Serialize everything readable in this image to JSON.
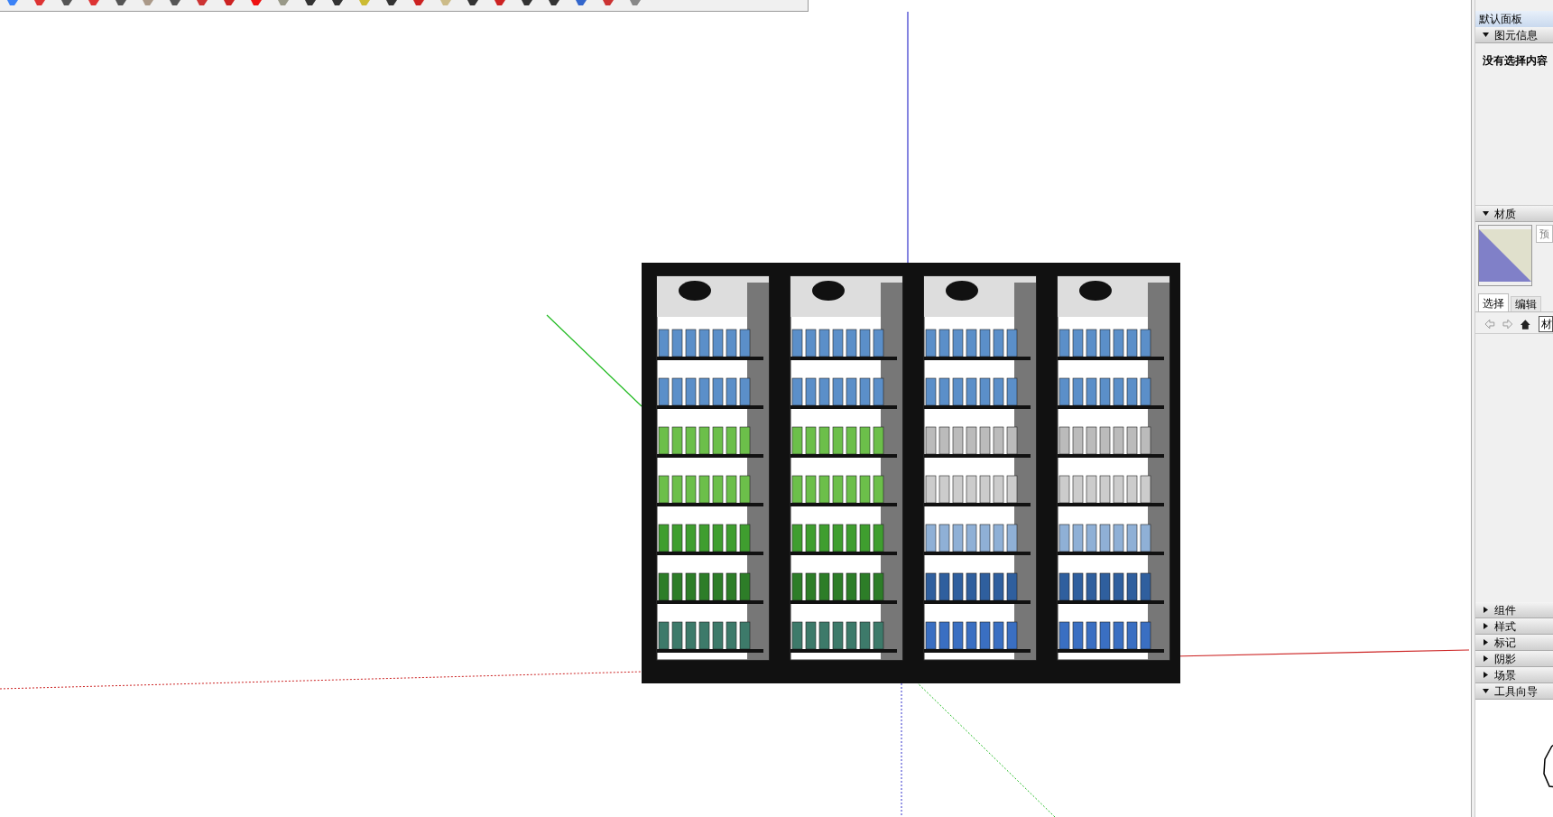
{
  "panel": {
    "title": "默认面板",
    "sections": [
      {
        "kind": "entity_info",
        "title": "图元信息",
        "expanded": true,
        "message": "没有选择内容"
      },
      {
        "kind": "materials",
        "title": "材质",
        "expanded": true,
        "button": "预",
        "tabs": [
          {
            "label": "选择",
            "selected": true
          },
          {
            "label": "编辑",
            "selected": false
          }
        ],
        "field_value": "材"
      },
      {
        "kind": "plain",
        "title": "组件",
        "expanded": false
      },
      {
        "kind": "plain",
        "title": "样式",
        "expanded": false
      },
      {
        "kind": "plain",
        "title": "标记",
        "expanded": false
      },
      {
        "kind": "plain",
        "title": "阴影",
        "expanded": false
      },
      {
        "kind": "plain",
        "title": "场景",
        "expanded": false
      },
      {
        "kind": "guide",
        "title": "工具向导",
        "expanded": true
      }
    ]
  }
}
